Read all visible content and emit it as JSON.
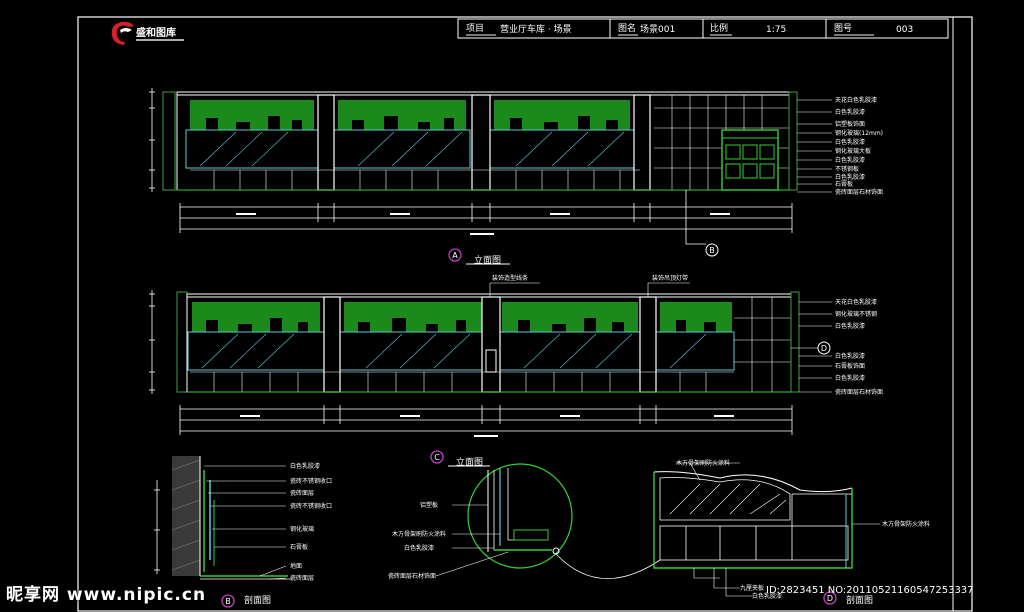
{
  "title_block": {
    "project_label": "项目",
    "project_value": "营业厅车库 · 场景",
    "drawing_label": "图名",
    "drawing_value": "场景001",
    "scale_label": "比例",
    "scale_value": "1:75",
    "sheet_label": "图号",
    "sheet_value": "003"
  },
  "logo": {
    "name": "盛和图库"
  },
  "views": {
    "elev_a": {
      "marker": "A",
      "title": "立面图"
    },
    "elev_c": {
      "marker": "C",
      "title": "立面图"
    },
    "section_b": {
      "marker": "B",
      "title": "剖面图"
    },
    "section_d": {
      "marker": "D",
      "title": "剖面图"
    }
  },
  "callouts": {
    "b": "B",
    "d": "D"
  },
  "elev_a_labels": [
    "天花白色乳胶漆",
    "白色乳胶漆",
    "铝塑板饰面",
    "钢化玻璃(12mm)",
    "白色乳胶漆",
    "钢化玻璃大板",
    "白色乳胶漆",
    "不锈钢板",
    "白色乳胶漆",
    "石膏板",
    "瓷砖面层石材饰面"
  ],
  "elev_c_labels": [
    "天花白色乳胶漆",
    "钢化玻璃不锈钢",
    "白色乳胶漆",
    "白色乳胶漆",
    "石膏板饰面",
    "白色乳胶漆",
    "瓷砖面层石材饰面"
  ],
  "elev_c_top_labels": [
    "装饰造型线条",
    "装饰吊顶灯带"
  ],
  "section_b_labels": [
    "白色乳胶漆",
    "瓷砖不锈钢收口",
    "瓷砖面层",
    "瓷砖不锈钢收口",
    "钢化玻璃",
    "石膏板",
    "地面",
    "瓷砖面层"
  ],
  "detail_labels": [
    "铝塑板",
    "木方骨架刷防火涂料",
    "白色乳胶漆",
    "瓷砖面层石材饰面"
  ],
  "section_d_labels": [
    "木方骨架刷防火涂料",
    "木方骨架防火涂料",
    "九厘夹板",
    "白色乳胶漆"
  ],
  "watermark": {
    "site": "昵享网 www.nipic.cn",
    "id": "ID:2823451  NO:20110521160547253337"
  }
}
